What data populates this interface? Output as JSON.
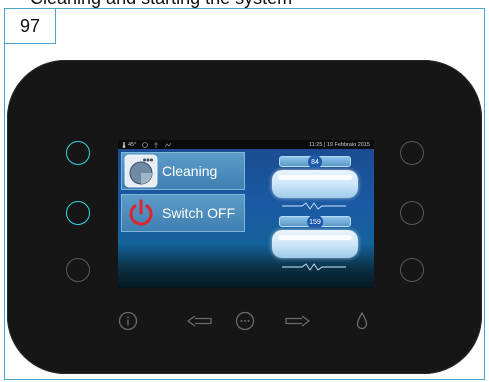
{
  "top_cut_caption": "Cleaning and starting the system",
  "page_number": "97",
  "status_bar": {
    "temperature": "45°",
    "datetime": "11:25 | 19 Febbraio 2015"
  },
  "menu": [
    {
      "label": "Cleaning",
      "icon": "cleaning-icon"
    },
    {
      "label": "Switch OFF",
      "icon": "power-icon"
    }
  ],
  "gauges": [
    {
      "value": "84"
    },
    {
      "value": "159"
    }
  ],
  "colors": {
    "frame_border": "#4aa7c4",
    "button_lit": "#38d7e8",
    "panel": "#161616",
    "power_red": "#e0242b"
  },
  "side_buttons": {
    "left": [
      "lit",
      "lit",
      "unlit"
    ],
    "right": [
      "unlit",
      "unlit",
      "unlit"
    ]
  },
  "bottom_icons": [
    "info-icon",
    "arrow-left-icon",
    "menu-dots-icon",
    "arrow-right-icon",
    "water-drop-icon"
  ]
}
